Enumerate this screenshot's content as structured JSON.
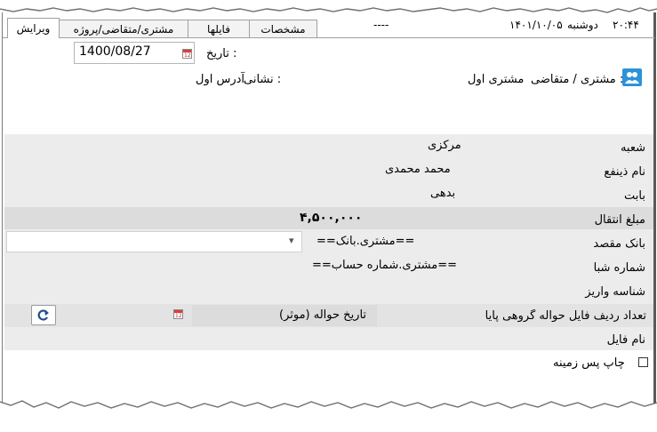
{
  "tabs": [
    {
      "label": "ویرایش",
      "active": true
    },
    {
      "label": "مشتری/متقاضی/پروژه",
      "active": false
    },
    {
      "label": "فایلها",
      "active": false
    },
    {
      "label": "مشخصات",
      "active": false
    }
  ],
  "status": {
    "dashes": "----",
    "date": "۱۴۰۱/۱۰/۰۵",
    "weekday": "دوشنبه",
    "time": "۲۰:۴۴"
  },
  "header": {
    "date_label": "تاریخ :",
    "date_value": "1400/08/27",
    "customer_label": "مشتری / متقاضی :",
    "customer_value": "مشتری اول",
    "address_label": "نشانی :",
    "address_value": "آدرس اول"
  },
  "form": {
    "branch_label": "شعبه",
    "branch_value": "مرکزی",
    "beneficiary_label": "نام ذینفع",
    "beneficiary_value": "محمد محمدی",
    "subject_label": "بابت",
    "subject_value": "بدهی",
    "amount_label": "مبلغ انتقال",
    "amount_value": "۴,۵۰۰,۰۰۰",
    "dest_bank_label": "بانک مقصد",
    "dest_bank_value": "==مشتری.بانک==",
    "sheba_label": "شماره شبا",
    "sheba_value": "==مشتری.شماره حساب==",
    "deposit_id_label": "شناسه واریز",
    "group_rows_label": "تعداد ردیف فایل حواله گروهی پایا",
    "effective_date_button": "تاریخ حواله (موثر)",
    "file_name_label": "نام فایل",
    "print_background_label": "چاپ پس زمینه"
  },
  "calendar_icon_text": "12",
  "colors": {
    "panel": "#ececec",
    "highlight": "#dcdcdc",
    "customer_icon": "#2c93d9",
    "refresh_icon": "#1f4f8a"
  }
}
